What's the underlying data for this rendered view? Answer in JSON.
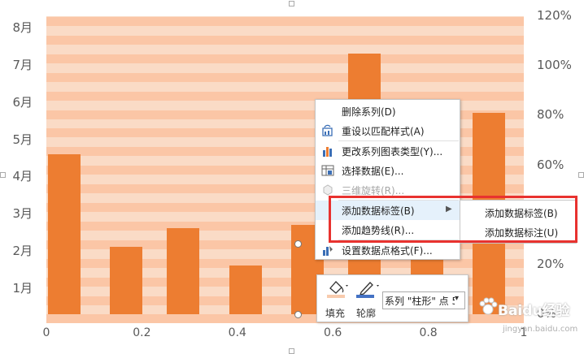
{
  "chart_data": {
    "type": "bar",
    "orientation": "vertical",
    "x": [
      0.03,
      0.16,
      0.28,
      0.41,
      0.54,
      0.66,
      0.79,
      0.92
    ],
    "values": [
      4.3,
      1.8,
      2.3,
      1.3,
      2.4,
      7.0,
      2.4,
      5.4
    ],
    "y_ticks_left": [
      "1月",
      "2月",
      "3月",
      "4月",
      "5月",
      "6月",
      "7月",
      "8月"
    ],
    "y_ticks_right": [
      "0%",
      "20%",
      "40%",
      "60%",
      "80%",
      "100%",
      "120%"
    ],
    "x_ticks": [
      "0",
      "0.2",
      "0.4",
      "0.6",
      "0.8",
      "1"
    ],
    "xlim": [
      0,
      1
    ],
    "ylim": [
      0,
      8
    ],
    "grid": "alternating horizontal bands",
    "colors": {
      "bar": "#ed7d31",
      "band_light": "#fadbc6",
      "band_dark": "#fbc6a6"
    }
  },
  "context_menu": {
    "items": [
      {
        "label": "删除系列(D)",
        "icon": "delete-series-icon",
        "disabled": false
      },
      {
        "label": "重设以匹配样式(A)",
        "icon": "reset-style-icon",
        "disabled": false
      },
      {
        "label": "更改系列图表类型(Y)...",
        "icon": "chart-type-icon",
        "disabled": false
      },
      {
        "label": "选择数据(E)...",
        "icon": "select-data-icon",
        "disabled": false
      },
      {
        "label": "三维旋转(R)...",
        "icon": "rotate-3d-icon",
        "disabled": true
      },
      {
        "label": "添加数据标签(B)",
        "icon": "",
        "disabled": false,
        "has_submenu": true
      },
      {
        "label": "添加趋势线(R)...",
        "icon": "",
        "disabled": false
      },
      {
        "label": "设置数据点格式(F)...",
        "icon": "format-point-icon",
        "disabled": false
      }
    ],
    "submenu": [
      "添加数据标签(B)",
      "添加数据标注(U)"
    ]
  },
  "mini_toolbar": {
    "fill_label": "填充",
    "outline_label": "轮廓",
    "series_select": "系列 \"柱形\" 点 5"
  },
  "watermark": {
    "text": "Baidu经验",
    "url": "jingyan.baidu.com"
  }
}
